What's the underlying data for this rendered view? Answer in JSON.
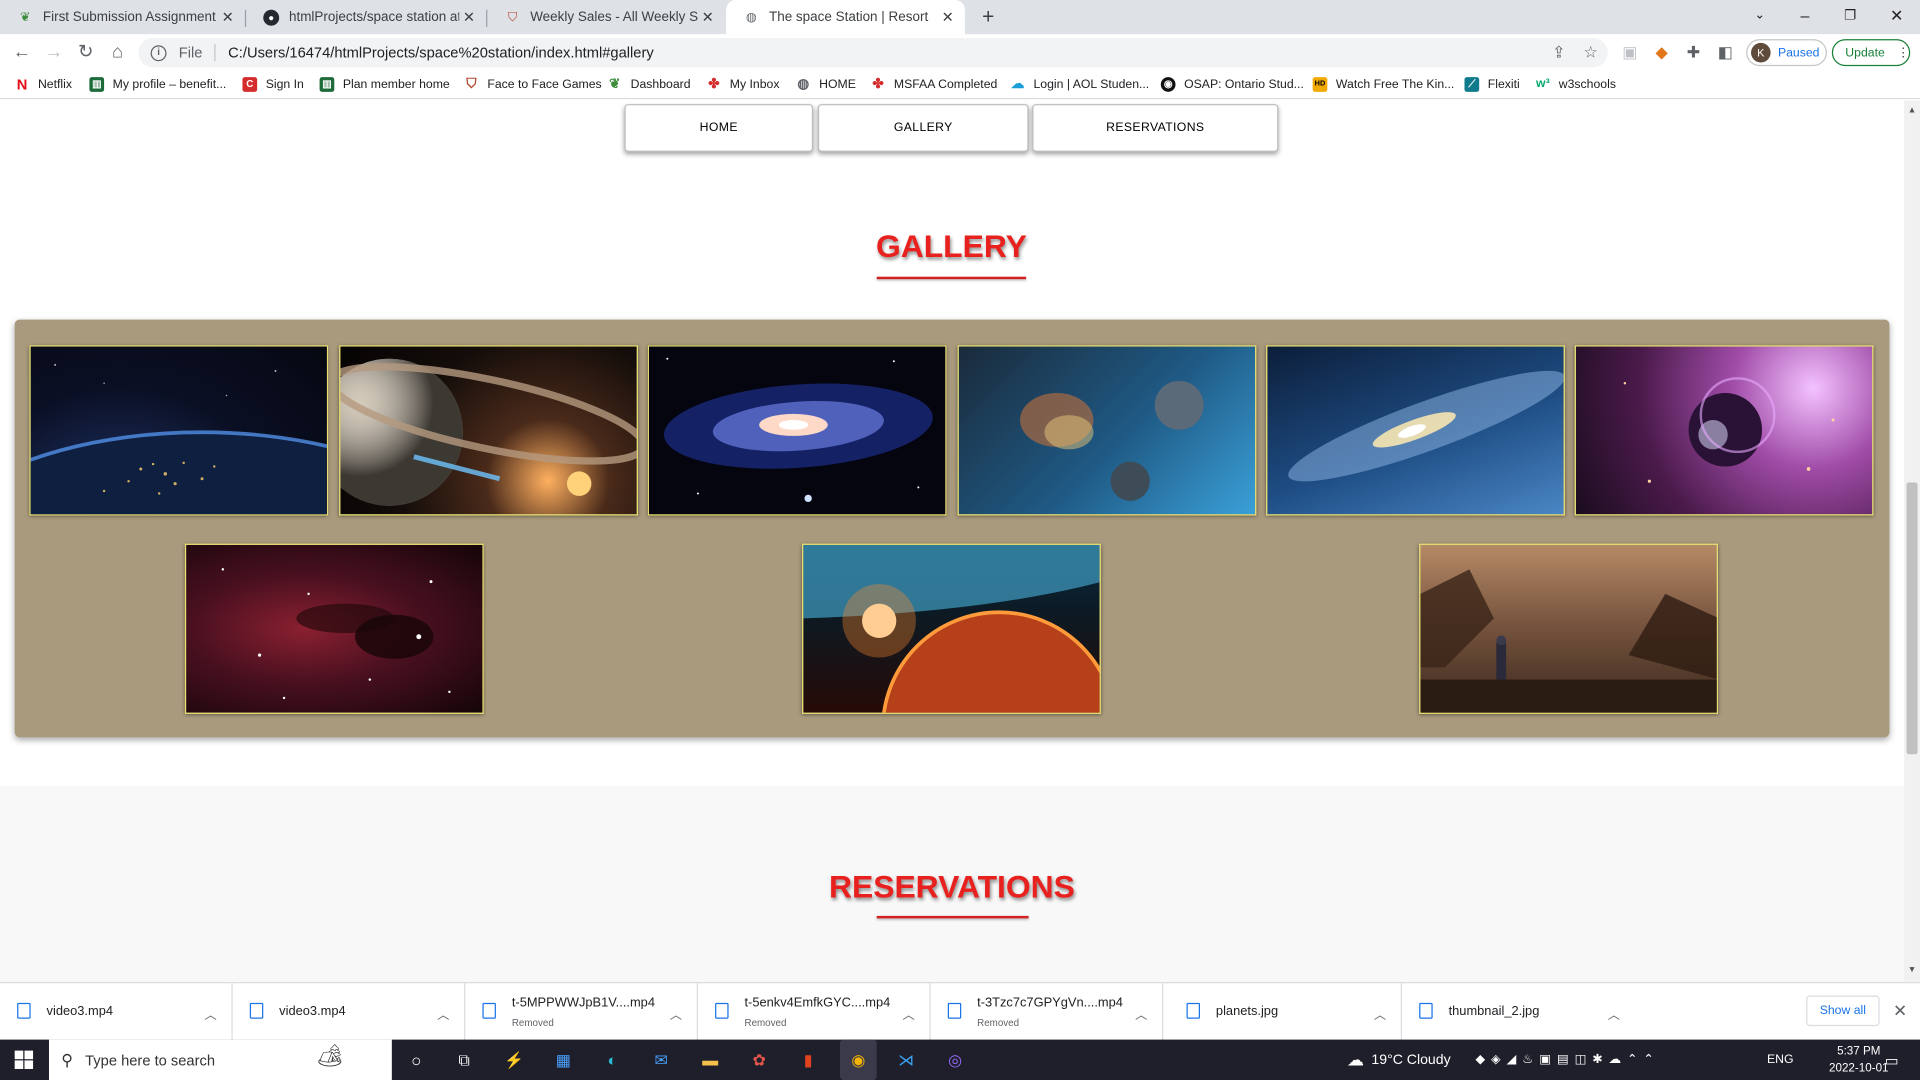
{
  "browser": {
    "tabs": [
      {
        "title": "First Submission Assignment",
        "icon": "leaf-icon",
        "active": false
      },
      {
        "title": "htmlProjects/space station at ma",
        "icon": "github-icon",
        "active": false
      },
      {
        "title": "Weekly Sales - All Weekly Sales -",
        "icon": "shield-icon",
        "active": false
      },
      {
        "title": "The space Station | Resort",
        "icon": "globe-icon",
        "active": true
      }
    ],
    "file_label": "File",
    "url": "C:/Users/16474/htmlProjects/space%20station/index.html#gallery",
    "profile_initial": "K",
    "profile_status": "Paused",
    "update_label": "Update",
    "bookmarks": [
      {
        "label": "Netflix",
        "icon": "netflix-icon"
      },
      {
        "label": "My profile – benefit...",
        "icon": "profile-icon"
      },
      {
        "label": "Sign In",
        "icon": "c-icon"
      },
      {
        "label": "Plan member home",
        "icon": "plan-icon"
      },
      {
        "label": "Face to Face Games",
        "icon": "shield-icon"
      },
      {
        "label": "Dashboard",
        "icon": "leaf-icon"
      },
      {
        "label": "My Inbox",
        "icon": "maple-leaf-icon"
      },
      {
        "label": "HOME",
        "icon": "globe-icon"
      },
      {
        "label": "MSFAA Completed",
        "icon": "maple-leaf-icon"
      },
      {
        "label": "Login | AOL Studen...",
        "icon": "cloud-icon"
      },
      {
        "label": "OSAP: Ontario Stud...",
        "icon": "osap-icon"
      },
      {
        "label": "Watch Free The Kin...",
        "icon": "hd-icon"
      },
      {
        "label": "Flexiti",
        "icon": "flexiti-icon"
      },
      {
        "label": "w3schools",
        "icon": "w3-icon"
      }
    ]
  },
  "site": {
    "nav": [
      "HOME",
      "GALLERY",
      "RESERVATIONS"
    ],
    "gallery_heading": "GALLERY",
    "reservations_heading": "RESERVATIONS",
    "gallery_images": [
      "earth-at-night-image",
      "ringed-planet-image",
      "spiral-galaxy-image",
      "nebula-planets-image",
      "blue-galaxy-image",
      "purple-planet-image",
      "red-nebula-image",
      "planet-sunrise-image",
      "ruined-planet-scene-image"
    ]
  },
  "downloads": {
    "items": [
      {
        "name": "video3.mp4",
        "status": ""
      },
      {
        "name": "video3.mp4",
        "status": ""
      },
      {
        "name": "t-5MPPWWJpB1V....mp4",
        "status": "Removed"
      },
      {
        "name": "t-5enkv4EmfkGYC....mp4",
        "status": "Removed"
      },
      {
        "name": "t-3Tzc7c7GPYgVn....mp4",
        "status": "Removed"
      },
      {
        "name": "planets.jpg",
        "status": ""
      },
      {
        "name": "thumbnail_2.jpg",
        "status": ""
      }
    ],
    "show_all": "Show all"
  },
  "taskbar": {
    "search_placeholder": "Type here to search",
    "weather": "19°C  Cloudy",
    "lang": "ENG",
    "time": "5:37 PM",
    "date": "2022-10-01"
  },
  "colors": {
    "heading_red": "#e8211e",
    "gallery_bg": "#a99a7d",
    "image_border": "#e9e070",
    "update_green": "#188038",
    "link_blue": "#1a73e8"
  }
}
